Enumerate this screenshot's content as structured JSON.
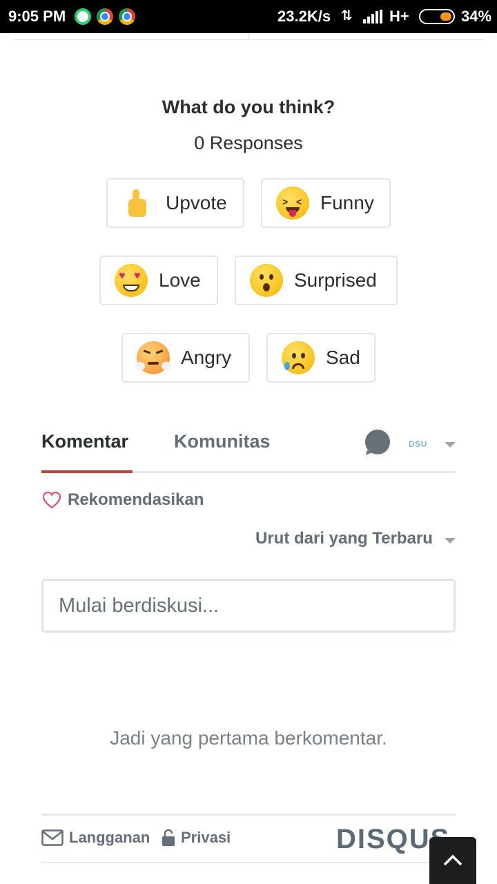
{
  "status_bar": {
    "time": "9:05 PM",
    "speed": "23.2K/s",
    "network": "H+",
    "battery": "34%",
    "battery_level": 0.34,
    "icons": [
      "whatsapp-icon",
      "chrome-icon",
      "chrome-icon",
      "data-arrows-icon",
      "signal-icon",
      "battery-icon"
    ]
  },
  "reactions": {
    "title": "What do you think?",
    "responses": "0 Responses",
    "items": [
      {
        "label": "Upvote",
        "icon": "thumbs-up-icon"
      },
      {
        "label": "Funny",
        "icon": "funny-face-icon"
      },
      {
        "label": "Love",
        "icon": "heart-eyes-icon"
      },
      {
        "label": "Surprised",
        "icon": "surprised-face-icon"
      },
      {
        "label": "Angry",
        "icon": "angry-face-icon"
      },
      {
        "label": "Sad",
        "icon": "sad-face-icon"
      }
    ]
  },
  "tabs": {
    "komentar": "Komentar",
    "komunitas": "Komunitas",
    "user_badge": "DSU",
    "accent_color": "#c8413b"
  },
  "recommend": {
    "label": "Rekomendasikan",
    "icon": "heart-outline-icon"
  },
  "sort": {
    "label": "Urut dari yang Terbaru"
  },
  "comment": {
    "placeholder": "Mulai berdiskusi..."
  },
  "empty_message": "Jadi yang pertama berkomentar.",
  "footer": {
    "subscribe": "Langganan",
    "privacy": "Privasi",
    "brand": "DISQUS"
  }
}
